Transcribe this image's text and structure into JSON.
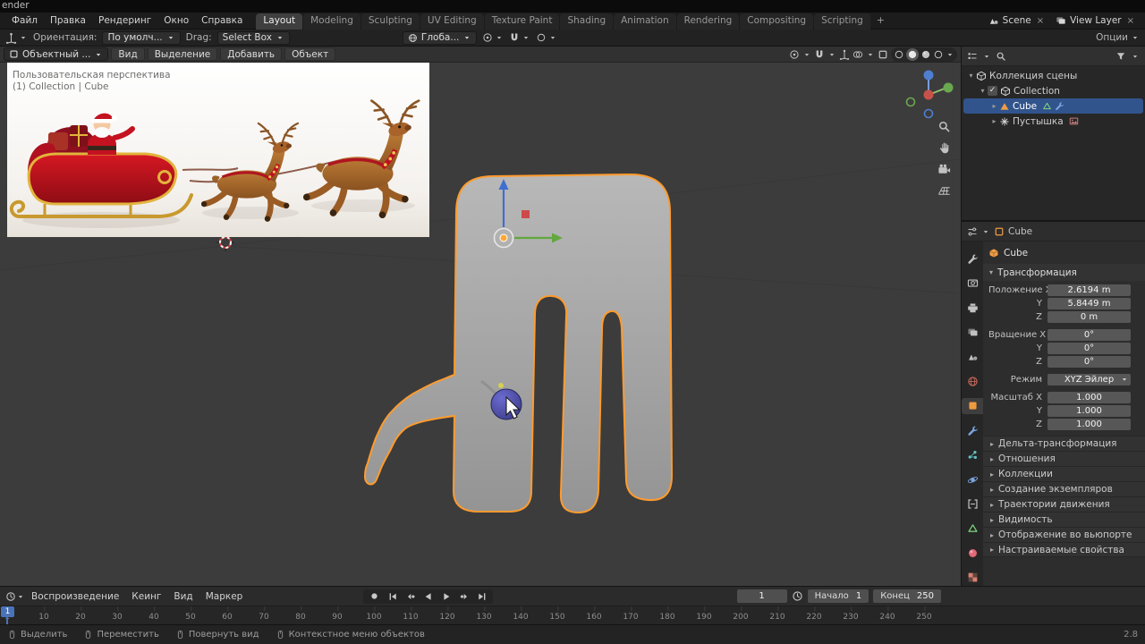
{
  "window": {
    "title_fragment": "ender"
  },
  "topbar": {
    "menus": [
      "Файл",
      "Правка",
      "Рендеринг",
      "Окно",
      "Справка"
    ],
    "workspaces": [
      {
        "label": "Layout",
        "active": true
      },
      {
        "label": "Modeling"
      },
      {
        "label": "Sculpting"
      },
      {
        "label": "UV Editing"
      },
      {
        "label": "Texture Paint"
      },
      {
        "label": "Shading"
      },
      {
        "label": "Animation"
      },
      {
        "label": "Rendering"
      },
      {
        "label": "Compositing"
      },
      {
        "label": "Scripting"
      }
    ],
    "add_label": "+",
    "scene_label": "Scene",
    "view_layer_label": "View Layer",
    "clear_glyph": "×"
  },
  "toolbar": {
    "orientation_label": "Ориентация:",
    "orientation_value": "По умолч...",
    "drag_label": "Drag:",
    "drag_value": "Select Box",
    "transform_space": "Глоба...",
    "options_label": "Опции"
  },
  "viewport": {
    "header": {
      "mode": "Объектный ...",
      "menus": [
        "Вид",
        "Выделение",
        "Добавить",
        "Объект"
      ]
    },
    "overlay": {
      "line1": "Пользовательская перспектива",
      "line2": "(1) Collection | Cube"
    }
  },
  "outliner": {
    "rows": [
      {
        "exp": "▾",
        "icon": "box",
        "icon_color": "#d9d9d9",
        "label": "Коллекция сцены",
        "depth": 0
      },
      {
        "exp": "▾",
        "check": true,
        "icon": "box",
        "icon_color": "#d9d9d9",
        "label": "Collection",
        "depth": 1
      },
      {
        "exp": "▸",
        "icon": "tri",
        "icon_color": "#ef9d45",
        "label": "Cube",
        "depth": 2,
        "selected": true,
        "badges": [
          {
            "icon": "trio",
            "color": "#7ed87e",
            "name": "mesh-data-icon"
          },
          {
            "icon": "wrench",
            "color": "#7aa5e0",
            "name": "modifier-icon"
          }
        ]
      },
      {
        "exp": "▸",
        "icon": "plainaxes",
        "icon_color": "#d9d9d9",
        "label": "Пустышка",
        "depth": 2,
        "badges": [
          {
            "icon": "image",
            "color": "#d98787",
            "name": "image-data-icon"
          }
        ]
      }
    ]
  },
  "properties": {
    "breadcrumb": "Cube",
    "object_name": "Cube",
    "transform_title": "Трансформация",
    "tabs": [
      {
        "name": "tool",
        "shape": "wrench",
        "color": "#c2c2c2"
      },
      {
        "name": "render",
        "shape": "camback",
        "color": "#c2c2c2"
      },
      {
        "name": "output",
        "shape": "printer",
        "color": "#c2c2c2"
      },
      {
        "name": "view-layer",
        "shape": "layers",
        "color": "#c2c2c2"
      },
      {
        "name": "scene",
        "shape": "scene",
        "color": "#c2c2c2"
      },
      {
        "name": "world",
        "shape": "globe",
        "color": "#d06a5c"
      },
      {
        "name": "object",
        "shape": "square",
        "color": "#ee9b3f",
        "active": true
      },
      {
        "name": "modifiers",
        "shape": "wrench",
        "color": "#7aa5e0"
      },
      {
        "name": "particles",
        "shape": "dots",
        "color": "#62c4c4"
      },
      {
        "name": "physics",
        "shape": "orbit",
        "color": "#7aa5e0"
      },
      {
        "name": "constraints",
        "shape": "clamp",
        "color": "#c2c2c2"
      },
      {
        "name": "object-data",
        "shape": "trio",
        "color": "#7ed87e"
      },
      {
        "name": "material",
        "shape": "ball",
        "color": "#e06a78"
      },
      {
        "name": "texture",
        "shape": "checker",
        "color": "#d98070"
      }
    ],
    "transform_rows": [
      {
        "label": "Положение X",
        "value": "2.6194 m"
      },
      {
        "label": "Y",
        "value": "5.8449 m"
      },
      {
        "label": "Z",
        "value": "0 m"
      },
      {
        "label": "Вращение X",
        "value": "0°",
        "gap_before": true
      },
      {
        "label": "Y",
        "value": "0°"
      },
      {
        "label": "Z",
        "value": "0°"
      },
      {
        "label": "Режим",
        "value": "XYZ Эйлер",
        "dropdown": true,
        "gap_before": true
      },
      {
        "label": "Масштаб X",
        "value": "1.000",
        "gap_before": true
      },
      {
        "label": "Y",
        "value": "1.000"
      },
      {
        "label": "Z",
        "value": "1.000"
      }
    ],
    "collapsed_sections": [
      "Дельта-трансформация",
      "Отношения",
      "Коллекции",
      "Создание экземпляров",
      "Траектории движения",
      "Видимость",
      "Отображение во вьюпорте",
      "Настраиваемые свойства"
    ]
  },
  "timeline": {
    "menus": [
      "Воспроизведение",
      "Кеинг",
      "Вид",
      "Маркер"
    ],
    "frame_current": "1",
    "playhead": "1",
    "start_label": "Начало",
    "start_value": "1",
    "end_label": "Конец",
    "end_value": "250",
    "ticks": [
      "1",
      "10",
      "20",
      "30",
      "40",
      "50",
      "60",
      "70",
      "80",
      "90",
      "100",
      "110",
      "120",
      "130",
      "140",
      "150",
      "160",
      "170",
      "180",
      "190",
      "200",
      "210",
      "220",
      "230",
      "240",
      "250"
    ]
  },
  "statusbar": {
    "hints": [
      {
        "label": "Выделить"
      },
      {
        "label": "Переместить"
      },
      {
        "label": "Повернуть вид"
      },
      {
        "label": "Контекстное меню объектов"
      }
    ],
    "version": "2.8"
  }
}
